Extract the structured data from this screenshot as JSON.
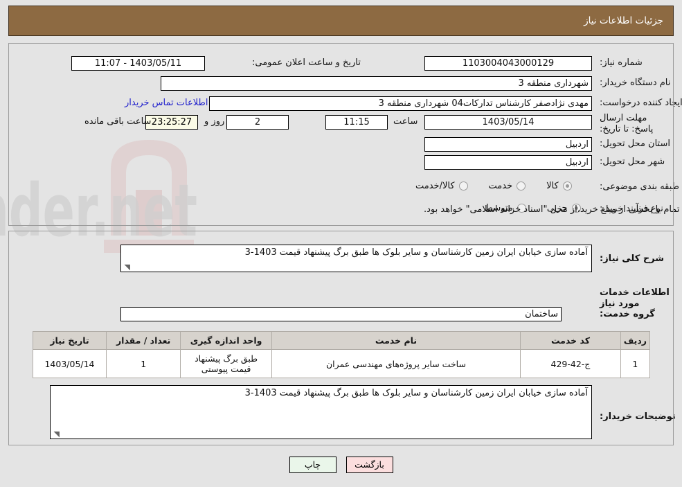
{
  "header": {
    "title": "جزئیات اطلاعات نیاز"
  },
  "colors": {
    "header_bg": "#8d6a42",
    "panel_border": "#9b9b9b",
    "page_bg": "#e4e4e4",
    "timer_bg": "#fbfbe6",
    "link": "#2222cc",
    "table_header_bg": "#d7d3cd",
    "btn_print_bg": "#eaf6ea",
    "btn_back_bg": "#fbdede"
  },
  "top": {
    "need_number_label": "شماره نیاز:",
    "need_number_value": "1103004043000129",
    "announce_label": "تاریخ و ساعت اعلان عمومی:",
    "announce_value": "1403/05/11 - 11:07",
    "buyer_org_label": "نام دستگاه خریدار:",
    "buyer_org_value": "شهرداری منطقه 3",
    "creator_label": "ایجاد کننده درخواست:",
    "creator_value": "مهدی نژادصفر کارشناس تدارکات04 شهرداری منطقه 3",
    "contact_link": "اطلاعات تماس خریدار",
    "deadline_label": "مهلت ارسال پاسخ: تا تاریخ:",
    "deadline_date": "1403/05/14",
    "hour_label": "ساعت",
    "deadline_time": "11:15",
    "days_value": "2",
    "days_label": "روز و",
    "countdown": "23:25:27",
    "remaining_label": "ساعت باقی مانده",
    "province_label": "استان محل تحویل:",
    "province_value": "اردبیل",
    "city_label": "شهر محل تحویل:",
    "city_value": "اردبیل",
    "category_label": "طبقه بندی موضوعی:",
    "category_options": [
      {
        "label": "کالا",
        "selected": true
      },
      {
        "label": "خدمت",
        "selected": false
      },
      {
        "label": "کالا/خدمت",
        "selected": false
      }
    ],
    "process_label": "نوع فرآیند خرید :",
    "process_options": [
      {
        "label": "جزیی",
        "selected": true
      },
      {
        "label": "متوسط",
        "selected": false
      }
    ],
    "treasury_checkbox_checked": false,
    "treasury_text": "پرداخت تمام یا بخشی از مبلغ خرید،از محل \"اسناد خزانه اسلامی\" خواهد بود."
  },
  "middle": {
    "summary_label": "شرح کلی نیاز:",
    "summary_value": "آماده سازی خیابان ایران زمین کارشناسان و سایر بلوک ها طبق برگ پیشنهاد قیمت 1403-3",
    "services_heading": "اطلاعات خدمات مورد نیاز",
    "service_group_label": "گروه خدمت:",
    "service_group_value": "ساختمان",
    "buyer_notes_label": "توضیحات خریدار:",
    "buyer_notes_value": "آماده سازی خیابان ایران زمین کارشناسان و سایر بلوک ها طبق برگ پیشنهاد قیمت 1403-3"
  },
  "table": {
    "columns": [
      "ردیف",
      "کد خدمت",
      "نام خدمت",
      "واحد اندازه گیری",
      "تعداد / مقدار",
      "تاریخ نیاز"
    ],
    "rows": [
      {
        "radif": "1",
        "code": "ج-42-429",
        "name": "ساخت سایر پروژه‌های مهندسی عمران",
        "unit": "طبق برگ پیشنهاد قیمت پیوستی",
        "qty": "1",
        "date": "1403/05/14"
      }
    ]
  },
  "buttons": {
    "print": "چاپ",
    "back": "بازگشت"
  },
  "watermark": {
    "text": "AriaTender.net"
  }
}
